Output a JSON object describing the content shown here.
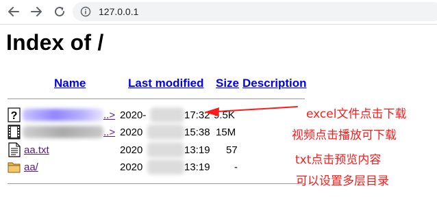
{
  "browser": {
    "url": "127.0.0.1",
    "back_icon": "arrow-left-icon",
    "forward_icon": "arrow-right-icon",
    "reload_icon": "reload-icon",
    "site_info_icon": "info-icon"
  },
  "page": {
    "title": "Index of /",
    "columns": {
      "name": "Name",
      "last_modified": "Last modified",
      "size": "Size",
      "description": "Description"
    },
    "rows": [
      {
        "icon": "unknown-file-icon",
        "name": "..>",
        "date": "2020-",
        "time": "17:32",
        "size": "9.5K"
      },
      {
        "icon": "video-file-icon",
        "name": "..>",
        "date": "2020",
        "time": "15:38",
        "size": "15M"
      },
      {
        "icon": "text-file-icon",
        "name": "aa.txt",
        "date": "2020",
        "time": "13:19",
        "size": "57"
      },
      {
        "icon": "folder-icon",
        "name": "aa/",
        "date": "2020",
        "time": "13:19",
        "size": "-"
      }
    ]
  },
  "annotations": {
    "excel": "excel文件点击下载",
    "video": "视频点击播放可下载",
    "txt": "txt点击预览内容",
    "folder": "可以设置多层目录",
    "color": "#ff1a1a"
  }
}
